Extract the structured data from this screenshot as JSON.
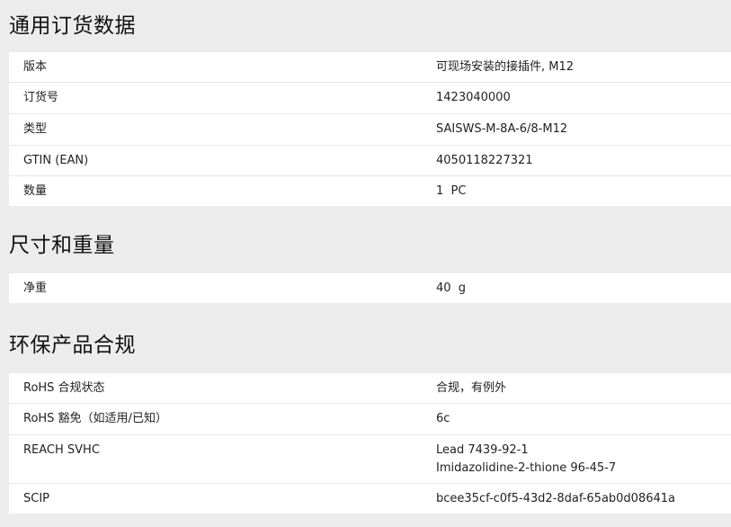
{
  "sections": [
    {
      "title": "通用订货数据",
      "rows": [
        {
          "label": "版本",
          "value": "可现场安装的接插件, M12"
        },
        {
          "label": "订货号",
          "value": "1423040000"
        },
        {
          "label": "类型",
          "value": "SAISWS-M-8A-6/8-M12"
        },
        {
          "label": "GTIN (EAN)",
          "value": "4050118227321"
        },
        {
          "label": "数量",
          "value": "1  PC"
        }
      ]
    },
    {
      "title": "尺寸和重量",
      "rows": [
        {
          "label": "净重",
          "value": "40  g"
        }
      ]
    },
    {
      "title": "环保产品合规",
      "rows": [
        {
          "label": "RoHS 合规状态",
          "value": "合规，有例外"
        },
        {
          "label": "RoHS 豁免（如适用/已知）",
          "value": "6c"
        },
        {
          "label": "REACH SVHC",
          "value_lines": [
            "Lead 7439-92-1",
            "Imidazolidine-2-thione 96-45-7"
          ]
        },
        {
          "label": "SCIP",
          "value": "bcee35cf-c0f5-43d2-8daf-65ab0d08641a"
        }
      ]
    }
  ]
}
